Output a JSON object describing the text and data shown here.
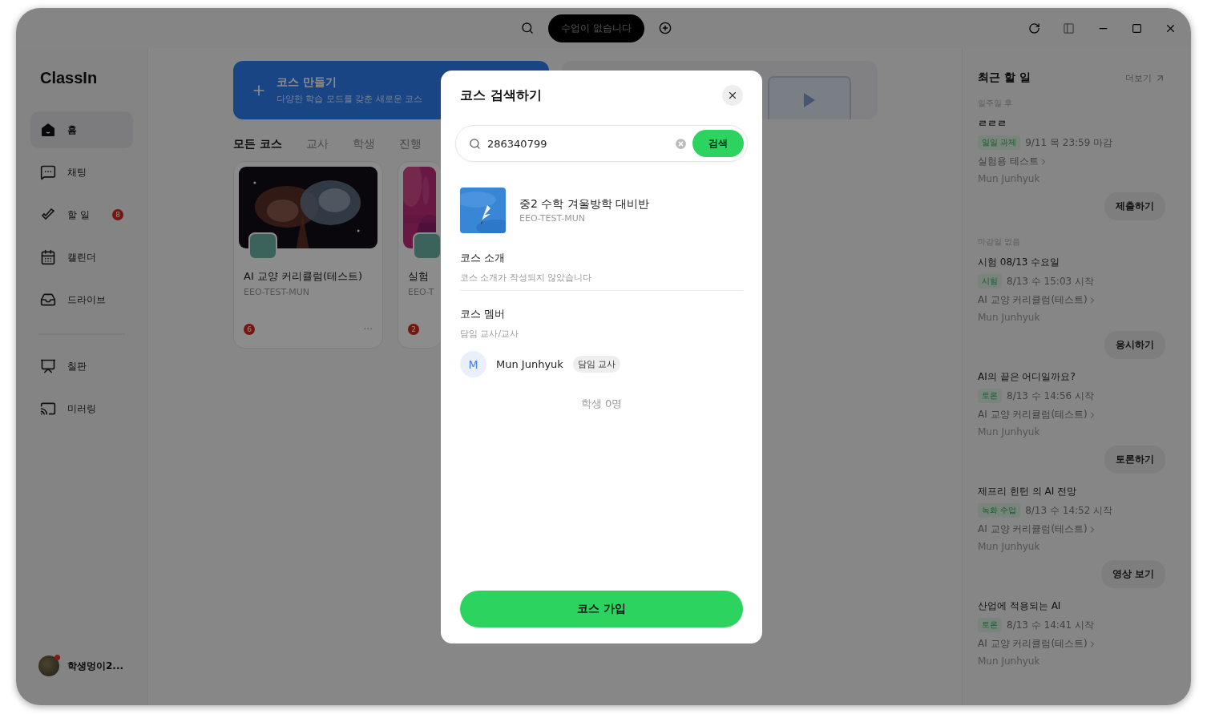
{
  "top_bar": {
    "status": "수업이 없습니다"
  },
  "sidebar": {
    "logo": "ClassIn",
    "items": [
      {
        "label": "홈",
        "selected": true
      },
      {
        "label": "채팅",
        "selected": false
      },
      {
        "label": "할 일",
        "selected": false,
        "badge": "8"
      },
      {
        "label": "캘린더",
        "selected": false
      },
      {
        "label": "드라이브",
        "selected": false
      }
    ],
    "tools": [
      {
        "label": "칠판",
        "selected": false
      },
      {
        "label": "미러링",
        "selected": false
      }
    ],
    "user": {
      "name": "학생멍이2..."
    }
  },
  "main": {
    "create_course": {
      "title": "코스 만들기",
      "subtitle": "다양한 학습 모드를 갖춘 새로운 코스"
    },
    "tabs": [
      {
        "label": "모든 코스",
        "selected": true
      },
      {
        "label": "교사",
        "selected": false
      },
      {
        "label": "학생",
        "selected": false
      },
      {
        "label": "진행",
        "selected": false
      }
    ],
    "courses": [
      {
        "title": "AI 교양 커리큘럼(테스트)",
        "code": "EEO-TEST-MUN",
        "badge": "6",
        "more": "···"
      },
      {
        "title": "실험",
        "code": "EEO-T",
        "badge": "2"
      }
    ]
  },
  "modal": {
    "title": "코스 검색하기",
    "search": {
      "value": "286340799",
      "button": "검색"
    },
    "result": {
      "name": "중2 수학 겨울방학 대비반",
      "code": "EEO-TEST-MUN"
    },
    "intro": {
      "heading": "코스 소개",
      "text": "코스 소개가 작성되지 않았습니다"
    },
    "members": {
      "heading": "코스 멤버",
      "role_group": "담임 교사/교사",
      "people": [
        {
          "initial": "M",
          "name": "Mun Junhyuk",
          "role": "담임 교사"
        }
      ],
      "students": "학생 0명"
    },
    "join_button": "코스 가입"
  },
  "todo_panel": {
    "title": "최근 할 일",
    "more": "더보기",
    "groups": [
      {
        "label": "일주일 후",
        "tasks": [
          {
            "title": "ㄹㄹㄹ",
            "tag": "일일 과제",
            "time": "9/11 목 23:59 마감",
            "course": "실험용 테스트",
            "author": "Mun Junhyuk",
            "action": "제출하기"
          }
        ]
      },
      {
        "label": "마감일 없음",
        "tasks": [
          {
            "title": "시험 08/13 수요일",
            "tag": "시험",
            "time": "8/13 수 15:03 시작",
            "course": "AI 교양 커리큘럼(테스트)",
            "author": "Mun Junhyuk",
            "action": "응시하기"
          },
          {
            "title": "AI의 끝은 어디일까요?",
            "tag": "토론",
            "time": "8/13 수 14:56 시작",
            "course": "AI 교양 커리큘럼(테스트)",
            "author": "Mun Junhyuk",
            "action": "토론하기"
          },
          {
            "title": "제프리 힌턴 의 AI 전망",
            "tag": "녹화 수업",
            "time": "8/13 수 14:52 시작",
            "course": "AI 교양 커리큘럼(테스트)",
            "author": "Mun Junhyuk",
            "action": "영상 보기"
          },
          {
            "title": "산업에 적용되는 AI",
            "tag": "토론",
            "time": "8/13 수 14:41 시작",
            "course": "AI 교양 커리큘럼(테스트)",
            "author": "Mun Junhyuk"
          }
        ]
      }
    ]
  }
}
